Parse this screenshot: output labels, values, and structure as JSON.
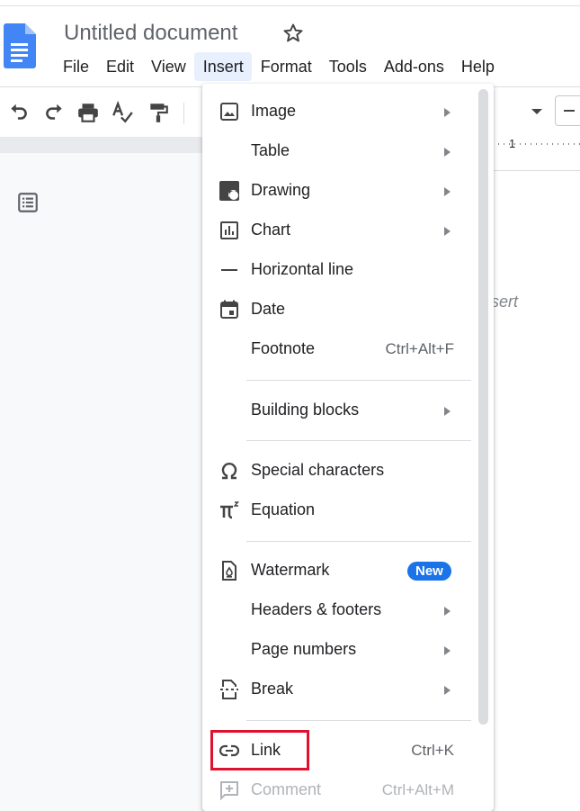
{
  "header": {
    "title": "Untitled document",
    "menus": [
      "File",
      "Edit",
      "View",
      "Insert",
      "Format",
      "Tools",
      "Add-ons",
      "Help"
    ],
    "active_menu": "Insert"
  },
  "toolbar": {
    "icons": [
      "undo-icon",
      "redo-icon",
      "print-icon",
      "spellcheck-icon",
      "paint-format-icon"
    ]
  },
  "ruler": {
    "mark": "1"
  },
  "page": {
    "hint_text": "sert"
  },
  "insert_menu": {
    "items": [
      {
        "label": "Image",
        "icon": "image-icon",
        "submenu": true
      },
      {
        "label": "Table",
        "icon": "",
        "submenu": true
      },
      {
        "label": "Drawing",
        "icon": "drawing-icon",
        "submenu": true
      },
      {
        "label": "Chart",
        "icon": "chart-icon",
        "submenu": true
      },
      {
        "label": "Horizontal line",
        "icon": "horizontal-line-icon",
        "submenu": false
      },
      {
        "label": "Date",
        "icon": "calendar-icon",
        "submenu": false
      },
      {
        "label": "Footnote",
        "icon": "",
        "shortcut": "Ctrl+Alt+F"
      },
      {
        "label": "Building blocks",
        "icon": "",
        "submenu": true
      },
      {
        "label": "Special characters",
        "icon": "omega-icon",
        "submenu": false
      },
      {
        "label": "Equation",
        "icon": "pi-icon",
        "submenu": false
      },
      {
        "label": "Watermark",
        "icon": "watermark-icon",
        "badge": "New"
      },
      {
        "label": "Headers & footers",
        "icon": "",
        "submenu": true
      },
      {
        "label": "Page numbers",
        "icon": "",
        "submenu": true
      },
      {
        "label": "Break",
        "icon": "break-icon",
        "submenu": true
      },
      {
        "label": "Link",
        "icon": "link-icon",
        "shortcut": "Ctrl+K"
      },
      {
        "label": "Comment",
        "icon": "comment-icon",
        "shortcut": "Ctrl+Alt+M",
        "disabled": true
      }
    ]
  },
  "colors": {
    "accent": "#1a73e8",
    "highlight": "#e0102f",
    "menu_active_bg": "#e8f0fe"
  }
}
